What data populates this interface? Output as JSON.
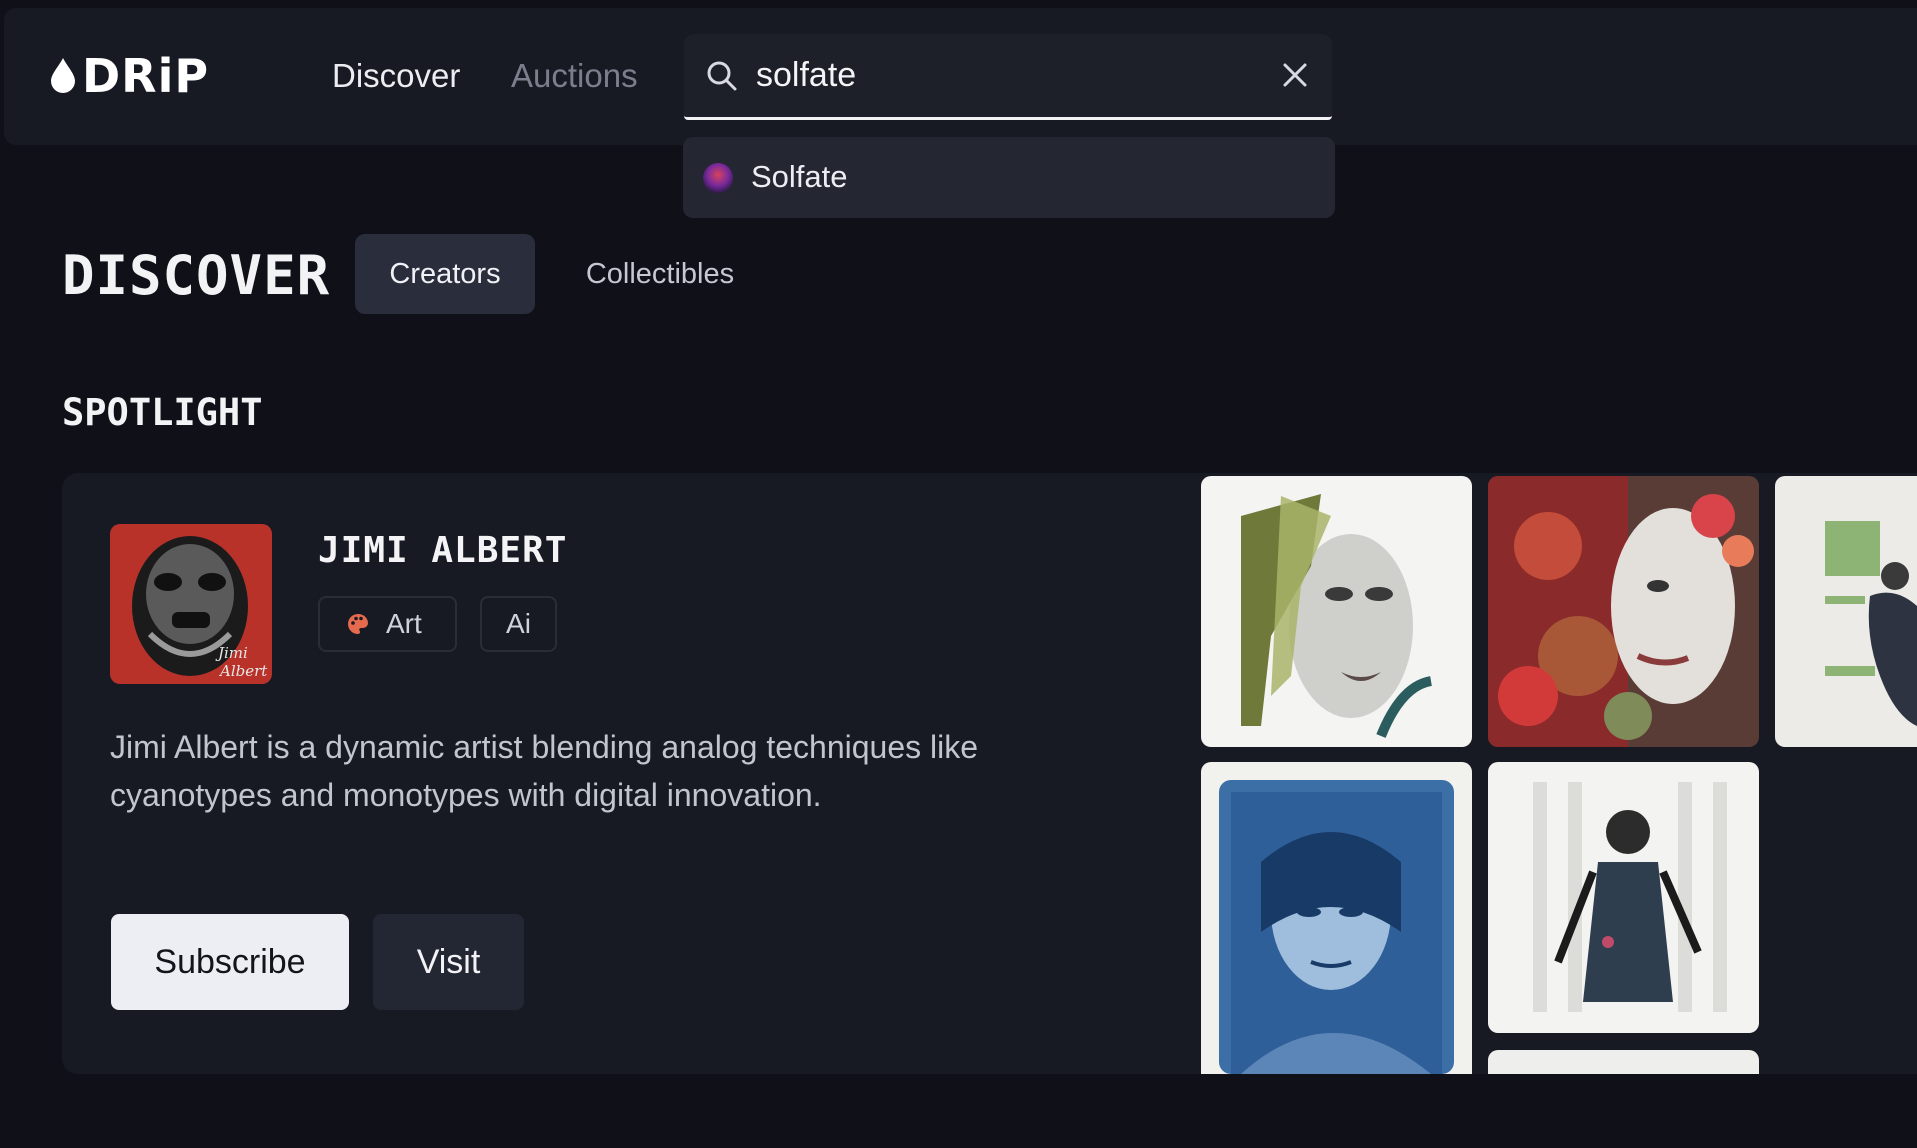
{
  "brand": {
    "logo_text": "DRiP",
    "logo_icon": "droplet-icon"
  },
  "nav": {
    "discover": "Discover",
    "auctions": "Auctions"
  },
  "search": {
    "value": "solfate",
    "search_icon": "search-icon",
    "clear_icon": "close-icon"
  },
  "suggestions": [
    {
      "label": "Solfate"
    }
  ],
  "discover": {
    "title": "DISCOVER",
    "tabs": [
      {
        "label": "Creators",
        "active": true
      },
      {
        "label": "Collectibles",
        "active": false
      }
    ]
  },
  "spotlight": {
    "title": "SPOTLIGHT",
    "creator": {
      "name": "JIMI ALBERT",
      "avatar_caption": "Jimi Albert",
      "tags": [
        {
          "label": "Art",
          "icon": "palette-icon"
        },
        {
          "label": "Ai"
        }
      ],
      "bio": "Jimi Albert is a dynamic artist blending analog techniques like cyanotypes and monotypes with digital innovation.",
      "subscribe_label": "Subscribe",
      "visit_label": "Visit"
    }
  },
  "colors": {
    "background": "#0f1018",
    "panel": "#181a23",
    "accent_text": "#f4f4f7"
  }
}
